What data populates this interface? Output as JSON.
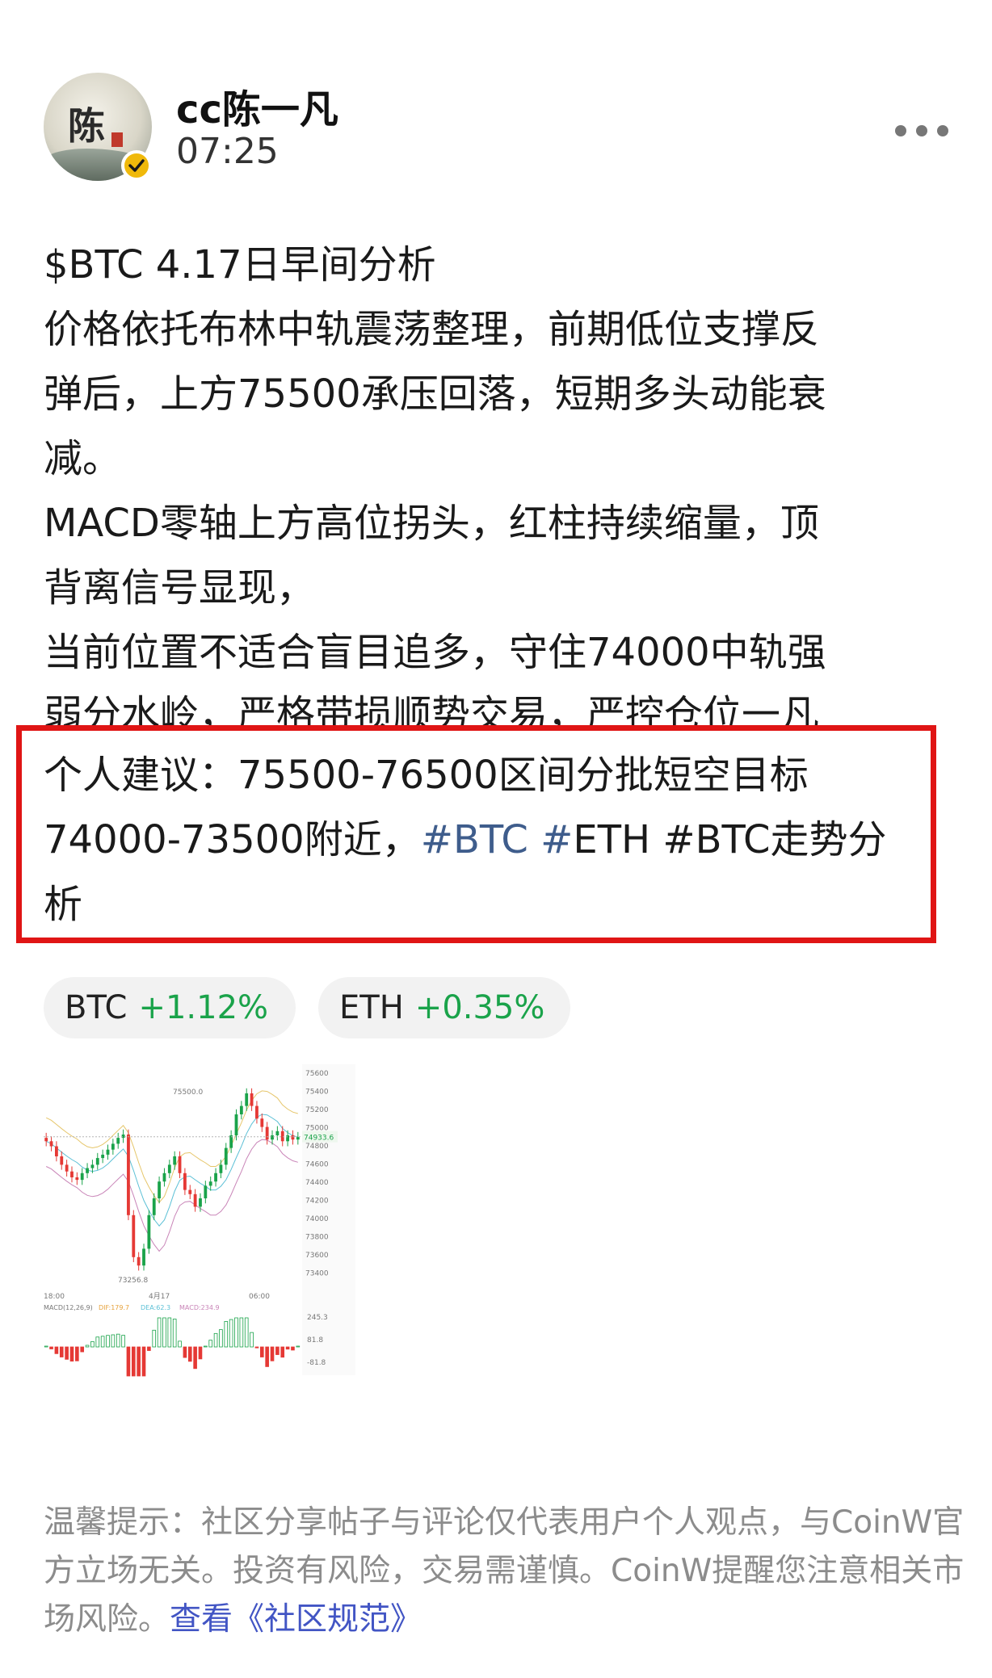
{
  "author": {
    "name": "cc陈一凡",
    "time": "07:25",
    "avatar_char": "陈",
    "verified_icon": "check-badge-icon",
    "more_icon": "more-dots-icon"
  },
  "post": {
    "title": "$BTC 4.17日早间分析",
    "lines": [
      "价格依托布林中轨震荡整理，前期低位支撑反",
      "弹后，上方75500承压回落，短期多头动能衰",
      "减。",
      "MACD零轴上方高位拐头，红柱持续缩量，顶",
      "背离信号显现，",
      "当前位置不适合盲目追多，守住74000中轨强"
    ],
    "faded_line": "弱分水岭，严格带损顺势交易，严控仓位一凡",
    "advice_line1": "个人建议：75500-76500区间分批短空目标",
    "advice_line2_prefix": "74000-73500附近，",
    "hashtags": [
      "#BTC",
      " #",
      "ETH #BTC走势分"
    ],
    "advice_line3": "析"
  },
  "tickers": [
    {
      "symbol": "BTC",
      "change": "+1.12%"
    },
    {
      "symbol": "ETH",
      "change": "+0.35%"
    }
  ],
  "colors": {
    "up": "#1aa34a",
    "down": "#e53935",
    "highlight_box": "#e01515",
    "link": "#4255c4",
    "hashtag": "#3f5d8c"
  },
  "chart_data": {
    "type": "candlestick",
    "price_ticks": [
      "75600",
      "75400",
      "75200",
      "75000",
      "74800",
      "74600",
      "74400",
      "74200",
      "74000",
      "73800",
      "73600",
      "73400"
    ],
    "current_price_label": "74933.6",
    "high_label": "75500.0",
    "low_label": "73256.8",
    "time_ticks": [
      "18:00",
      "4月17",
      "06:00"
    ],
    "macd_title": "MACD(12,26,9)",
    "macd_dif": "DIF:179.7",
    "macd_dea": "DEA:62.3",
    "macd_val": "MACD:234.9",
    "macd_ticks": [
      "245.3",
      "81.8",
      "-81.8"
    ],
    "close": [
      74880,
      74820,
      74700,
      74600,
      74520,
      74450,
      74420,
      74500,
      74560,
      74600,
      74680,
      74720,
      74780,
      74850,
      74920,
      74960,
      74000,
      73500,
      73400,
      73600,
      74000,
      74200,
      74400,
      74500,
      74600,
      74700,
      74500,
      74300,
      74250,
      74100,
      74200,
      74350,
      74400,
      74500,
      74600,
      74800,
      74950,
      75200,
      75300,
      75450,
      75300,
      75150,
      75050,
      74900,
      74950,
      75000,
      74880,
      74950,
      74900,
      74930
    ],
    "ylim": [
      73200,
      75700
    ]
  },
  "notice": {
    "text": "温馨提示：社区分享帖子与评论仅代表用户个人观点，与CoinW官方立场无关。投资有风险，交易需谨慎。CoinW提醒您注意相关市场风险。",
    "link": "查看《社区规范》"
  }
}
